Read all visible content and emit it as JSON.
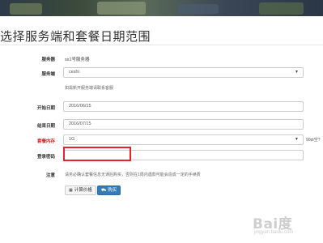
{
  "page": {
    "title": "选择服务端和套餐日期范围"
  },
  "form": {
    "server": {
      "label": "服务器",
      "value": "ss1号服务器"
    },
    "server_side": {
      "label": "服务端",
      "value": "ceshi",
      "help": "如需新开服务端请联系客服"
    },
    "start_date": {
      "label": "开始日期",
      "value": "2016/06/15"
    },
    "end_date": {
      "label": "结束日期",
      "value": "2016/07/15"
    },
    "plan_memory": {
      "label": "套餐内存",
      "value": "1G",
      "suffix": "90₥空?"
    },
    "login_password": {
      "label": "登录密码",
      "value": ""
    },
    "notice": {
      "label": "注意",
      "text": "请务必确认套餐信息无误后购买，否则在1周内遇款可能会造成一定的手续费"
    }
  },
  "buttons": {
    "calculate_label": "计算价格",
    "buy_label": "购买"
  },
  "watermark": {
    "text": "Bai度",
    "sub": "jingyan.baidu.com"
  },
  "colors": {
    "highlight": "#e8222c",
    "primary": "#337ab7",
    "required_label": "#cc2222"
  }
}
